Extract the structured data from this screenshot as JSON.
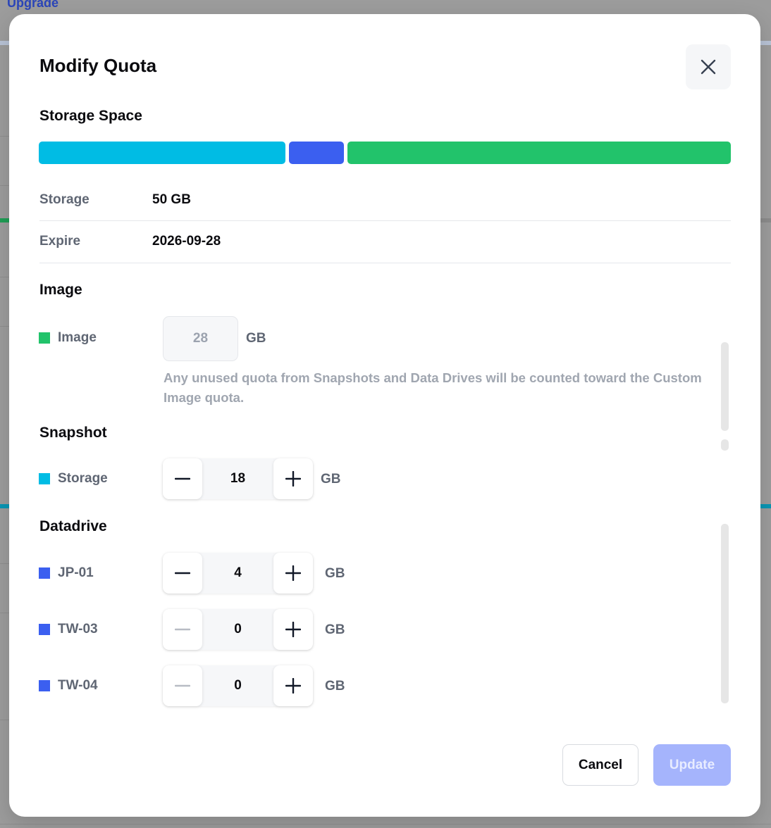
{
  "background": {
    "upgrade_link": "Upgrade"
  },
  "modal": {
    "title": "Modify Quota",
    "storage_space": {
      "title": "Storage Space",
      "segments": [
        {
          "name": "snapshot",
          "color": "#00bce4",
          "fraction": 0.36
        },
        {
          "name": "datadrive",
          "color": "#3b5ff0",
          "fraction": 0.08
        },
        {
          "name": "image",
          "color": "#22c36b",
          "fraction": 0.56
        }
      ],
      "rows": [
        {
          "label": "Storage",
          "value": "50 GB"
        },
        {
          "label": "Expire",
          "value": "2026-09-28"
        }
      ]
    },
    "image": {
      "title": "Image",
      "label": "Image",
      "color": "#22c36b",
      "value": "28",
      "unit": "GB",
      "hint": "Any unused quota from Snapshots and Data Drives will be counted toward the Custom Image quota."
    },
    "snapshot": {
      "title": "Snapshot",
      "label": "Storage",
      "color": "#00bce4",
      "value": "18",
      "unit": "GB"
    },
    "datadrive": {
      "title": "Datadrive",
      "color": "#3b5ff0",
      "unit": "GB",
      "items": [
        {
          "label": "JP-01",
          "value": "4"
        },
        {
          "label": "TW-03",
          "value": "0"
        },
        {
          "label": "TW-04",
          "value": "0"
        }
      ]
    },
    "actions": {
      "cancel": "Cancel",
      "update": "Update"
    }
  },
  "icons": {
    "close": "close-icon",
    "minus": "minus-icon",
    "plus": "plus-icon"
  }
}
